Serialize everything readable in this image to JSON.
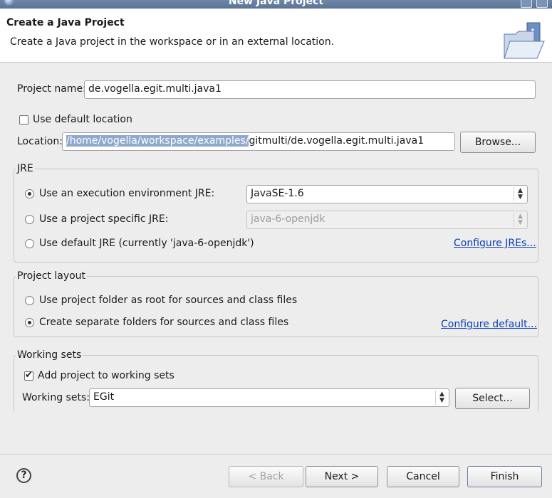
{
  "window": {
    "title": "New Java Project"
  },
  "header": {
    "title": "Create a Java Project",
    "description": "Create a Java project in the workspace or in an external location."
  },
  "project_name": {
    "label": "Project name:",
    "value": "de.vogella.egit.multi.java1"
  },
  "default_location": {
    "label": "Use default location",
    "checked": false
  },
  "location": {
    "label": "Location:",
    "value_selected": "/home/vogella/workspace/examples/",
    "value_rest": "gitmulti/de.vogella.egit.multi.java1",
    "browse_label": "Browse..."
  },
  "jre": {
    "group_title": "JRE",
    "option_env": "Use an execution environment JRE:",
    "env_value": "JavaSE-1.6",
    "option_specific": "Use a project specific JRE:",
    "specific_value": "java-6-openjdk",
    "option_default": "Use default JRE (currently 'java-6-openjdk')",
    "configure_link": "Configure JREs..."
  },
  "layout": {
    "group_title": "Project layout",
    "option_root": "Use project folder as root for sources and class files",
    "option_separate": "Create separate folders for sources and class files",
    "configure_link": "Configure default..."
  },
  "working_sets": {
    "group_title": "Working sets",
    "add_label": "Add project to working sets",
    "add_checked": true,
    "sets_label": "Working sets:",
    "sets_value": "EGit",
    "select_label": "Select..."
  },
  "footer": {
    "help": "?",
    "back": "< Back",
    "next": "Next >",
    "cancel": "Cancel",
    "finish": "Finish"
  }
}
